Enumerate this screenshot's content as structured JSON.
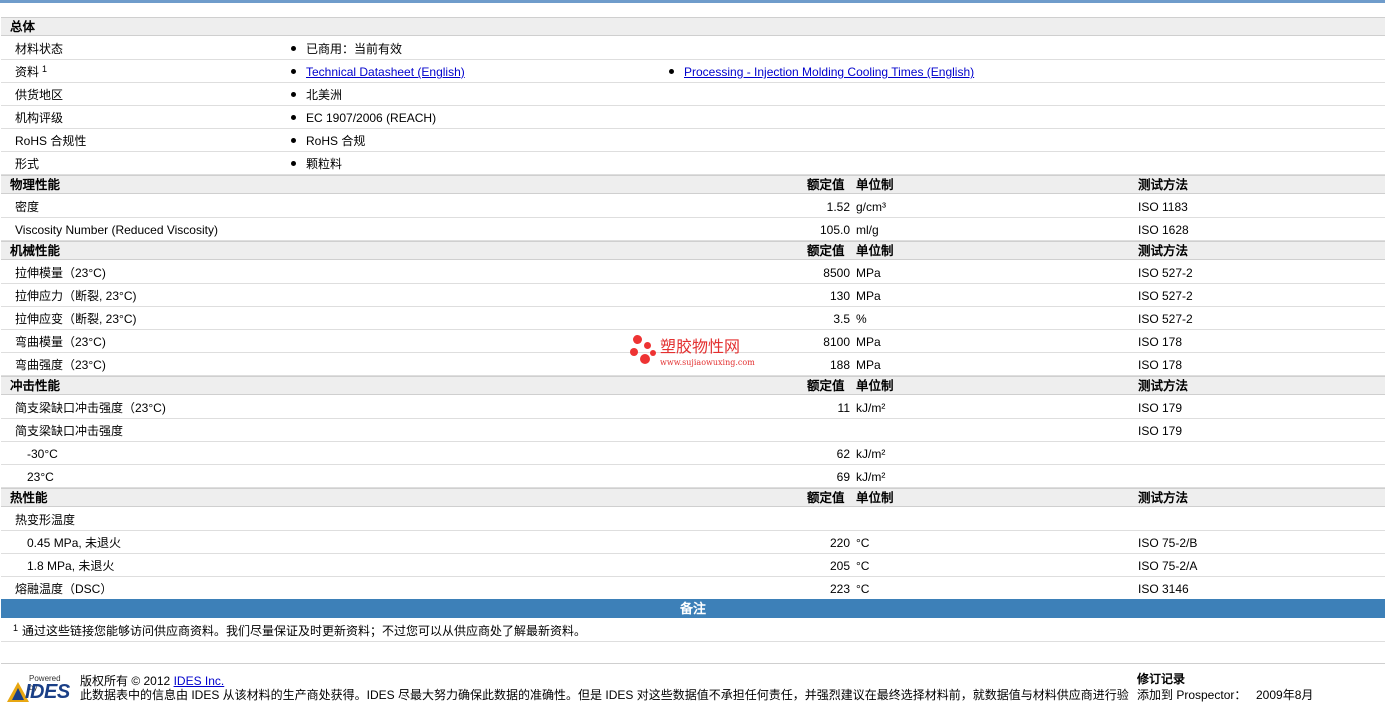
{
  "general": {
    "title": "总体",
    "rows": [
      {
        "label": "材料状态",
        "values": [
          "已商用：当前有效"
        ]
      },
      {
        "label": "资料",
        "sup": "1",
        "links": [
          "Technical Datasheet (English)",
          "Processing - Injection Molding Cooling Times (English)"
        ]
      },
      {
        "label": "供货地区",
        "values": [
          "北美洲"
        ]
      },
      {
        "label": "机构评级",
        "values": [
          "EC 1907/2006 (REACH)"
        ]
      },
      {
        "label": "RoHS 合规性",
        "values": [
          "RoHS 合规"
        ]
      },
      {
        "label": "形式",
        "values": [
          "颗粒料"
        ]
      }
    ]
  },
  "headers": {
    "rated": "额定值",
    "unit": "单位制",
    "method": "测试方法"
  },
  "physical": {
    "title": "物理性能",
    "rows": [
      {
        "label": "密度",
        "value": "1.52",
        "unit": "g/cm³",
        "method": "ISO 1183"
      },
      {
        "label": "Viscosity Number (Reduced Viscosity)",
        "value": "105.0",
        "unit": "ml/g",
        "method": "ISO 1628"
      }
    ]
  },
  "mechanical": {
    "title": "机械性能",
    "rows": [
      {
        "label": "拉伸模量（23°C)",
        "value": "8500",
        "unit": "MPa",
        "method": "ISO 527-2"
      },
      {
        "label": "拉伸应力（断裂, 23°C)",
        "value": "130",
        "unit": "MPa",
        "method": "ISO 527-2"
      },
      {
        "label": "拉伸应变（断裂, 23°C)",
        "value": "3.5",
        "unit": "%",
        "method": "ISO 527-2"
      },
      {
        "label": "弯曲模量（23°C)",
        "value": "8100",
        "unit": "MPa",
        "method": "ISO 178"
      },
      {
        "label": "弯曲强度（23°C)",
        "value": "188",
        "unit": "MPa",
        "method": "ISO 178"
      }
    ]
  },
  "impact": {
    "title": "冲击性能",
    "rows": [
      {
        "label": "简支梁缺口冲击强度（23°C)",
        "value": "11",
        "unit": "kJ/m²",
        "method": "ISO 179"
      },
      {
        "label": "简支梁缺口冲击强度",
        "value": "",
        "unit": "",
        "method": "ISO 179"
      },
      {
        "label": "-30°C",
        "value": "62",
        "unit": "kJ/m²",
        "method": ""
      },
      {
        "label": "23°C",
        "value": "69",
        "unit": "kJ/m²",
        "method": ""
      }
    ]
  },
  "thermal": {
    "title": "热性能",
    "rows": [
      {
        "label": "热变形温度",
        "value": "",
        "unit": "",
        "method": ""
      },
      {
        "label": "0.45 MPa, 未退火",
        "value": "220",
        "unit": "°C",
        "method": "ISO 75-2/B"
      },
      {
        "label": "1.8 MPa, 未退火",
        "value": "205",
        "unit": "°C",
        "method": "ISO 75-2/A"
      },
      {
        "label": "熔融温度（DSC）",
        "value": "223",
        "unit": "°C",
        "method": "ISO 3146"
      }
    ]
  },
  "notes": {
    "title": "备注",
    "sup": "1",
    "footnote": "通过这些链接您能够访问供应商资料。我们尽量保证及时更新资料；不过您可以从供应商处了解最新资料。"
  },
  "watermark": {
    "main": "塑胶物性网",
    "sub": "www.sujiaowuxing.com"
  },
  "footer": {
    "powered_by": "Powered by",
    "logo_text": "IDES",
    "copyright": "版权所有 © 2012",
    "company_link": "IDES Inc.",
    "disclaimer": "此数据表中的信息由 IDES 从该材料的生产商处获得。IDES 尽最大努力确保此数据的准确性。但是 IDES 对这些数据值不承担任何责任，并强烈建议在最终选择材料前，就数据值与材料供应商进行验",
    "revision_title": "修订记录",
    "revision_label": "添加到 Prospector：",
    "revision_date": "2009年8月"
  },
  "colors": {
    "notes_bar": "#3d80b8",
    "link": "#0000cc",
    "section_bg": "#eeeeee",
    "watermark": "#e33030"
  }
}
